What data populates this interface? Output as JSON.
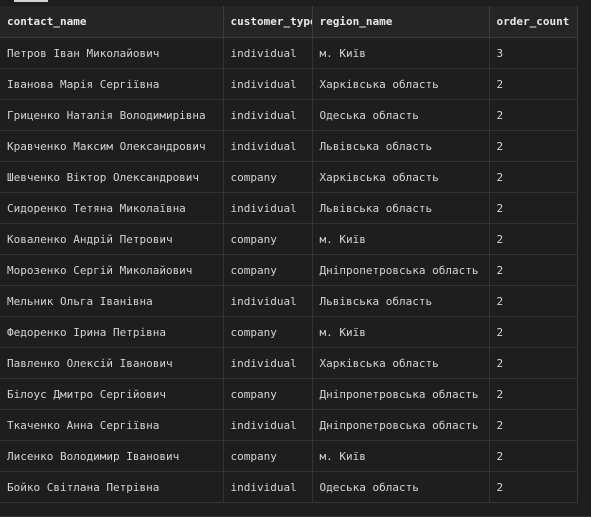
{
  "table": {
    "columns": [
      "contact_name",
      "customer_type",
      "region_name",
      "order_count"
    ],
    "rows": [
      [
        "Петров Іван Миколайович",
        "individual",
        "м. Київ",
        "3"
      ],
      [
        "Іванова Марія Сергіївна",
        "individual",
        "Харківська область",
        "2"
      ],
      [
        "Гриценко Наталія Володимирівна",
        "individual",
        "Одеська область",
        "2"
      ],
      [
        "Кравченко Максим Олександрович",
        "individual",
        "Львівська область",
        "2"
      ],
      [
        "Шевченко Віктор Олександрович",
        "company",
        "Харківська область",
        "2"
      ],
      [
        "Сидоренко Тетяна Миколаївна",
        "individual",
        "Львівська область",
        "2"
      ],
      [
        "Коваленко Андрій Петрович",
        "company",
        "м. Київ",
        "2"
      ],
      [
        "Морозенко Сергій Миколайович",
        "company",
        "Дніпропетровська область",
        "2"
      ],
      [
        "Мельник Ольга Іванівна",
        "individual",
        "Львівська область",
        "2"
      ],
      [
        "Федоренко Ірина Петрівна",
        "company",
        "м. Київ",
        "2"
      ],
      [
        "Павленко Олексій Іванович",
        "individual",
        "Харківська область",
        "2"
      ],
      [
        "Білоус Дмитро Сергійович",
        "company",
        "Дніпропетровська область",
        "2"
      ],
      [
        "Ткаченко Анна Сергіївна",
        "individual",
        "Дніпропетровська область",
        "2"
      ],
      [
        "Лисенко Володимир Іванович",
        "company",
        "м. Київ",
        "2"
      ],
      [
        "Бойко Світлана Петрівна",
        "individual",
        "Одеська область",
        "2"
      ]
    ]
  }
}
